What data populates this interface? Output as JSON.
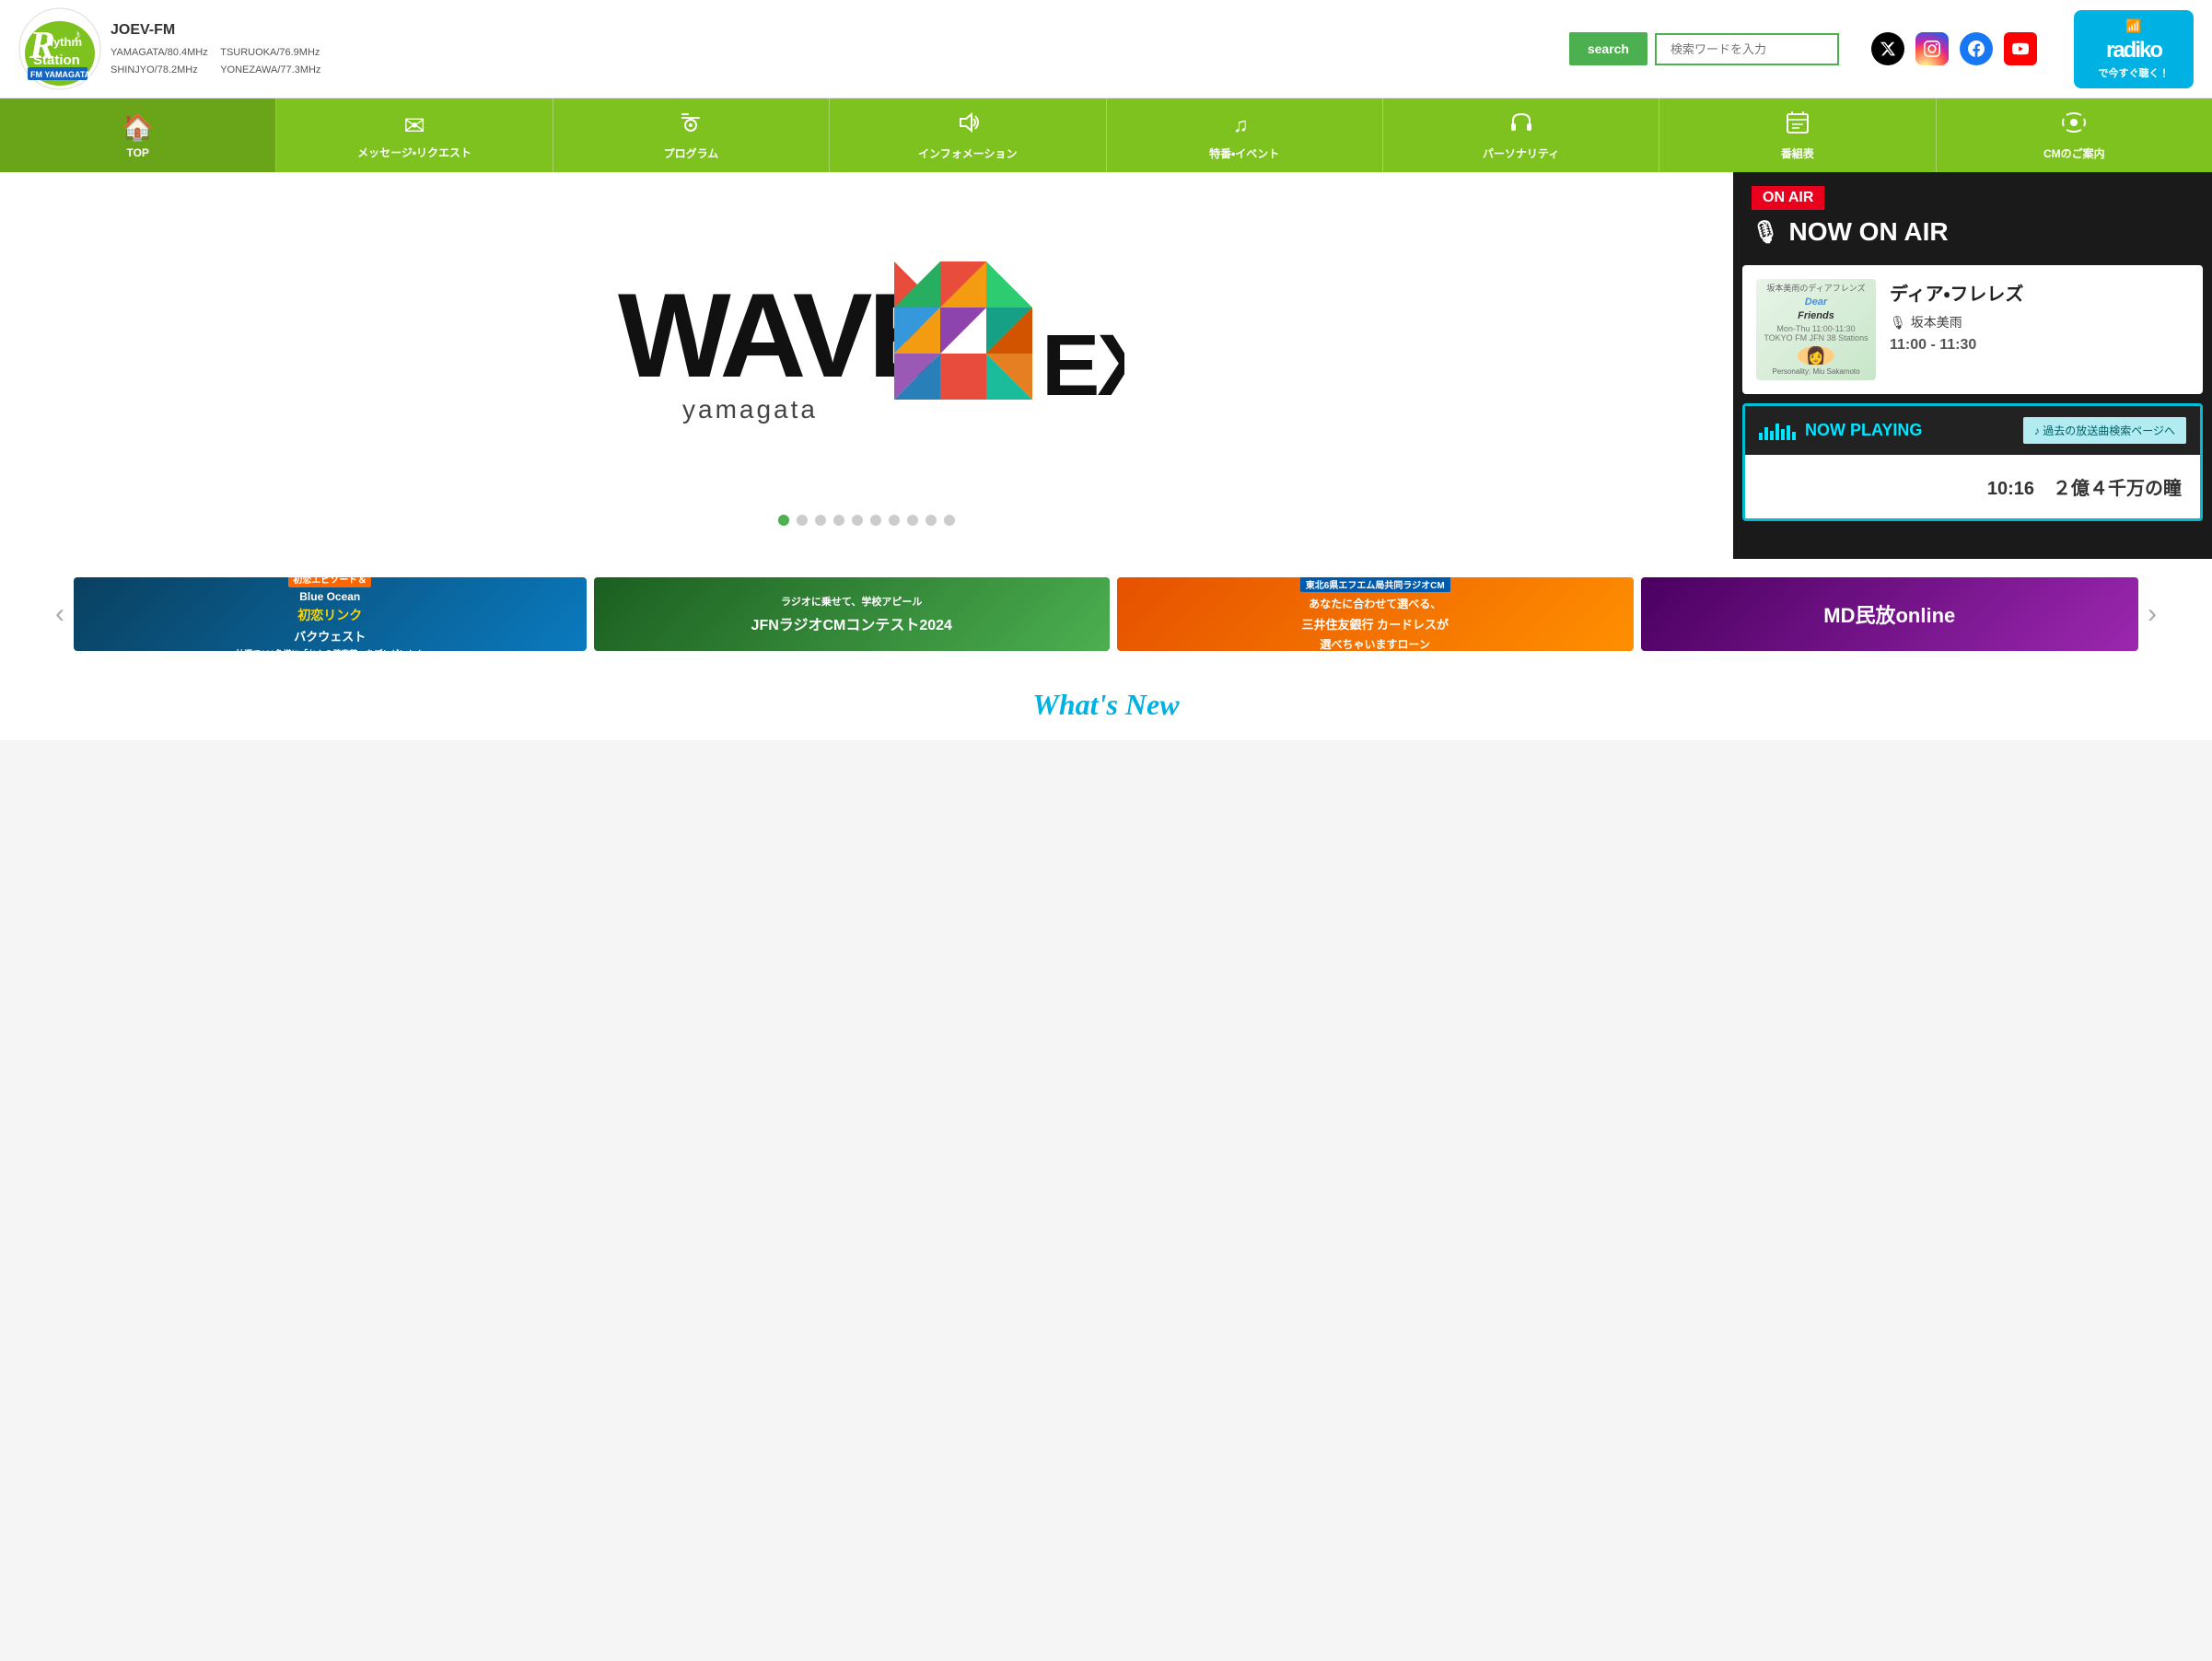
{
  "header": {
    "station_name": "JOEV-FM",
    "frequencies": [
      "YAMAGATA/80.4MHz",
      "TSURUOKA/76.9MHz",
      "SHINJYO/78.2MHz",
      "YONEZAWA/77.3MHz"
    ],
    "search_button": "search",
    "search_placeholder": "検索ワードを入力",
    "radiko_label": "radiko",
    "radiko_sub": "で今すぐ聴く！"
  },
  "nav": {
    "items": [
      {
        "id": "top",
        "label": "TOP",
        "icon": "🏠"
      },
      {
        "id": "message",
        "label": "メッセージ・リクエスト",
        "icon": "✉"
      },
      {
        "id": "program",
        "label": "プログラム",
        "icon": "📻"
      },
      {
        "id": "info",
        "label": "インフォメーション",
        "icon": "🔊"
      },
      {
        "id": "special",
        "label": "特番・イベント",
        "icon": "🎵"
      },
      {
        "id": "personality",
        "label": "パーソナリティ",
        "icon": "🎧"
      },
      {
        "id": "schedule",
        "label": "番組表",
        "icon": "📋"
      },
      {
        "id": "cm",
        "label": "CMのご案内",
        "icon": "📡"
      }
    ]
  },
  "slider": {
    "wave_text": "WAVE",
    "yamagata_text": "yamagata",
    "exceed_text": "EXCEED",
    "dots_count": 10,
    "active_dot": 0
  },
  "onair": {
    "badge": "ON AIR",
    "title": "NOW ON AIR",
    "program_name": "ディア・フレレズ",
    "personality_label": "坂本美雨",
    "time": "11:00 - 11:30",
    "dear_friends_title": "Dear Friends",
    "dear_friends_subtitle": "坂本美雨のディアフレンズ",
    "broadcast_info": "Mon-Thu 11:00-11:30\nTOKYO FM JFN 38 Stations",
    "personality_detail": "Personality: Miu Sakamoto"
  },
  "now_playing": {
    "header": "NOW PLAYING",
    "past_search": "♪ 過去の放送曲検索ページへ",
    "song_info": "10:16　２億４千万の瞳",
    "bars": [
      8,
      14,
      10,
      18,
      12,
      16,
      9
    ]
  },
  "banners": [
    {
      "id": "banner1",
      "text": "初恋リンク\nバクウェスト",
      "bg": "#0a5e8a"
    },
    {
      "id": "banner2",
      "text": "JFNラジオCMコンテスト2024",
      "bg": "#2e7d32"
    },
    {
      "id": "banner3",
      "text": "三井住友銀行 カードレス",
      "bg": "#f57c00"
    },
    {
      "id": "banner4",
      "text": "MD民放online",
      "bg": "#6a0f6a"
    }
  ],
  "whats_new": {
    "title": "What's New"
  }
}
